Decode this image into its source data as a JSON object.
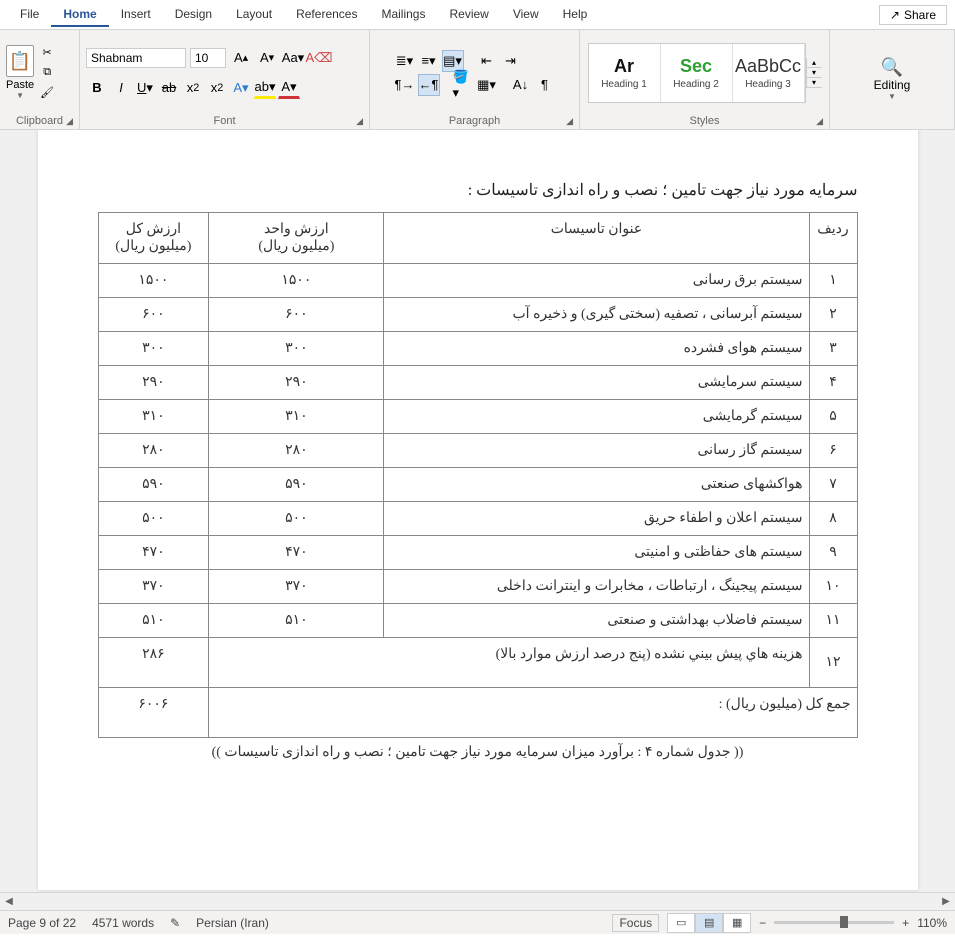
{
  "menubar": {
    "items": [
      "File",
      "Home",
      "Insert",
      "Design",
      "Layout",
      "References",
      "Mailings",
      "Review",
      "View",
      "Help"
    ],
    "active_index": 1,
    "share": "Share"
  },
  "ribbon": {
    "clipboard": {
      "label": "Clipboard",
      "paste": "Paste"
    },
    "font": {
      "label": "Font",
      "name": "Shabnam",
      "size": "10"
    },
    "paragraph": {
      "label": "Paragraph"
    },
    "styles": {
      "label": "Styles",
      "items": [
        {
          "preview": "Ar",
          "label": "Heading 1",
          "color": "#111",
          "weight": "900"
        },
        {
          "preview": "Sec",
          "label": "Heading 2",
          "color": "#2ca030",
          "weight": "900"
        },
        {
          "preview": "AaBbCc",
          "label": "Heading 3",
          "color": "#333",
          "weight": "400"
        }
      ]
    },
    "editing": {
      "label": "Editing"
    }
  },
  "document": {
    "title_text": "سرمایه مورد نیاز جهت تامین ؛ نصب و راه اندازی تاسیسات :",
    "headers": [
      "ردیف",
      "عنوان تاسیسات",
      "ارزش واحد\n(میلیون ریال)",
      "ارزش کل\n(میلیون ریال)"
    ],
    "rows": [
      {
        "idx": "۱",
        "name": "سیستم برق رسانی",
        "unit": "۱۵۰۰",
        "total": "۱۵۰۰"
      },
      {
        "idx": "۲",
        "name": "سیستم آبرسانی ، تصفیه (سختی گیری) و ذخیره آب",
        "unit": "۶۰۰",
        "total": "۶۰۰"
      },
      {
        "idx": "۳",
        "name": "سیستم هوای فشرده",
        "unit": "۳۰۰",
        "total": "۳۰۰"
      },
      {
        "idx": "۴",
        "name": "سیستم سرمایشی",
        "unit": "۲۹۰",
        "total": "۲۹۰"
      },
      {
        "idx": "۵",
        "name": "سیستم گرمایشی",
        "unit": "۳۱۰",
        "total": "۳۱۰"
      },
      {
        "idx": "۶",
        "name": "سیستم گاز رسانی",
        "unit": "۲۸۰",
        "total": "۲۸۰"
      },
      {
        "idx": "۷",
        "name": "هواکشهای صنعتی",
        "unit": "۵۹۰",
        "total": "۵۹۰"
      },
      {
        "idx": "۸",
        "name": "سیستم اعلان و اطفاء حریق",
        "unit": "۵۰۰",
        "total": "۵۰۰"
      },
      {
        "idx": "۹",
        "name": "سیستم های حفاظتی و امنیتی",
        "unit": "۴۷۰",
        "total": "۴۷۰"
      },
      {
        "idx": "۱۰",
        "name": "سیستم پیجینگ ، ارتباطات ، مخابرات و اینترانت داخلی",
        "unit": "۳۷۰",
        "total": "۳۷۰"
      },
      {
        "idx": "۱۱",
        "name": "سیستم فاضلاب بهداشتی و صنعتی",
        "unit": "۵۱۰",
        "total": "۵۱۰"
      }
    ],
    "row12": {
      "idx": "۱۲",
      "name": "هزينه هاي پيش بيني نشده (پنج درصد ارزش موارد بالا)",
      "total": "۲۸۶"
    },
    "footer": {
      "label": "جمع کل (میلیون ریال) :",
      "total": "۶۰۰۶"
    },
    "caption": "(( جدول شماره ۴ : برآورد میزان سرمایه مورد نیاز جهت تامین ؛ نصب و راه اندازی تاسیسات ))"
  },
  "status": {
    "page": "Page 9 of 22",
    "words": "4571 words",
    "lang": "Persian (Iran)",
    "focus": "Focus",
    "zoom": "110%"
  }
}
